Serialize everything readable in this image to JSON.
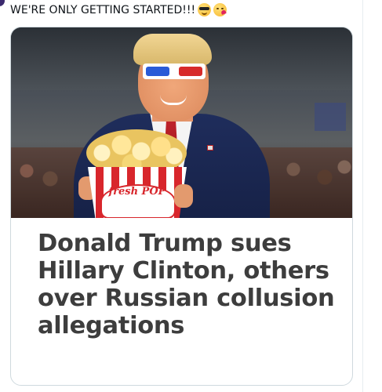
{
  "tweet": {
    "text": "WE'RE ONLY GETTING STARTED!!!",
    "emojis": [
      "smiling-face-with-sunglasses",
      "face-blowing-a-kiss"
    ]
  },
  "card": {
    "image_description_icon": "photo",
    "popcorn_label": "fresh POP",
    "headline": "Donald Trump sues Hillary Clinton, others over Russian collusion allegations"
  },
  "colors": {
    "text": "#0f1419",
    "headline": "#3d3d3d",
    "card_border": "#cfd9de",
    "accent_red": "#d8262c",
    "suit_blue": "#1f2d5c"
  }
}
